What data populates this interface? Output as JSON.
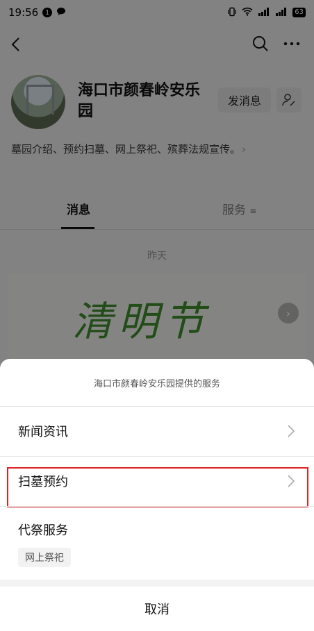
{
  "status": {
    "time": "19:56",
    "notif_count": "1",
    "battery": "63"
  },
  "header": {
    "title": "海口市颜春岭安乐园",
    "send_message": "发消息",
    "description": "墓园介绍、预约扫墓、网上祭祀、殡葬法规宣传。",
    "icons": [
      "back-icon",
      "search-icon",
      "more-icon",
      "user-icon",
      "chevron-right-icon"
    ]
  },
  "tabs": [
    {
      "label": "消息",
      "active": true
    },
    {
      "label": "服务",
      "active": false
    }
  ],
  "feed": {
    "date": "昨天",
    "banner_text": "清明节"
  },
  "sheet": {
    "header": "海口市颜春岭安乐园提供的服务",
    "items": [
      {
        "label": "新闻资讯"
      },
      {
        "label": "扫墓预约"
      },
      {
        "label": "代祭服务",
        "tags": [
          "网上祭祀"
        ]
      }
    ],
    "cancel": "取消"
  },
  "colors": {
    "highlight": "#e02020",
    "accent_green": "#3f8a2c"
  }
}
